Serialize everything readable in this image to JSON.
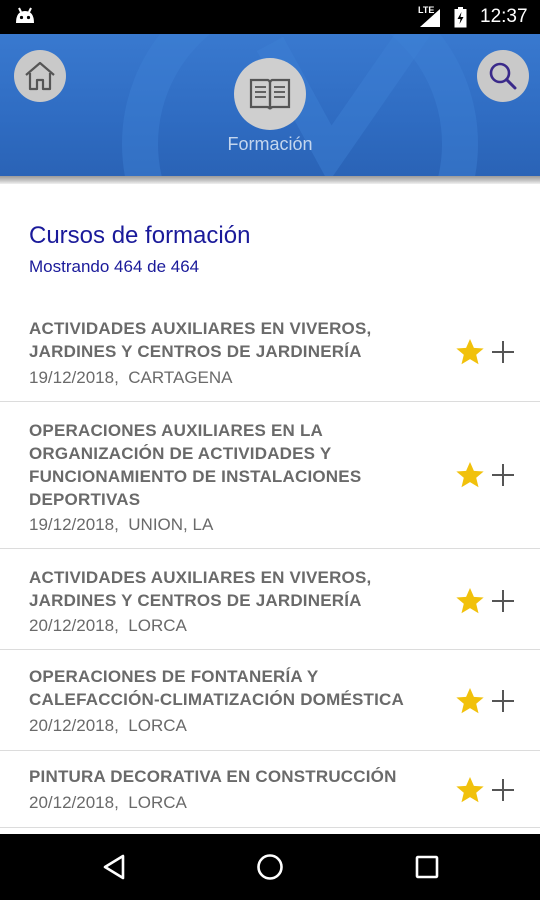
{
  "status_bar": {
    "network_label": "LTE",
    "time": "12:37"
  },
  "header": {
    "title": "Formación",
    "home_icon": "home-icon",
    "search_icon": "search-icon",
    "section_icon": "book-icon",
    "colors": {
      "primary": "#2f72c9",
      "button_bg": "#c9c9c9"
    }
  },
  "list": {
    "title": "Cursos de formación",
    "count_text": "Mostrando 464 de 464",
    "colors": {
      "heading": "#1a1a9a",
      "item_text": "#6a6a6a",
      "star": "#f1c10c"
    },
    "items": [
      {
        "title": "ACTIVIDADES AUXILIARES EN VIVEROS, JARDINES Y CENTROS DE JARDINERÍA",
        "date": "19/12/2018,",
        "location": "CARTAGENA",
        "favorite": true
      },
      {
        "title": "OPERACIONES AUXILIARES EN LA ORGANIZACIÓN DE ACTIVIDADES Y FUNCIONAMIENTO DE INSTALACIONES DEPORTIVAS",
        "date": "19/12/2018,",
        "location": "UNION, LA",
        "favorite": true
      },
      {
        "title": "ACTIVIDADES AUXILIARES EN VIVEROS, JARDINES Y CENTROS DE JARDINERÍA",
        "date": "20/12/2018,",
        "location": "LORCA",
        "favorite": true
      },
      {
        "title": "OPERACIONES DE FONTANERÍA Y CALEFACCIÓN-CLIMATIZACIÓN DOMÉSTICA",
        "date": "20/12/2018,",
        "location": "LORCA",
        "favorite": true
      },
      {
        "title": "PINTURA DECORATIVA EN CONSTRUCCIÓN",
        "date": "20/12/2018,",
        "location": "LORCA",
        "favorite": true
      }
    ]
  },
  "nav_bar": {
    "back_icon": "back-triangle-icon",
    "home_icon": "home-circle-icon",
    "recents_icon": "recents-square-icon"
  }
}
